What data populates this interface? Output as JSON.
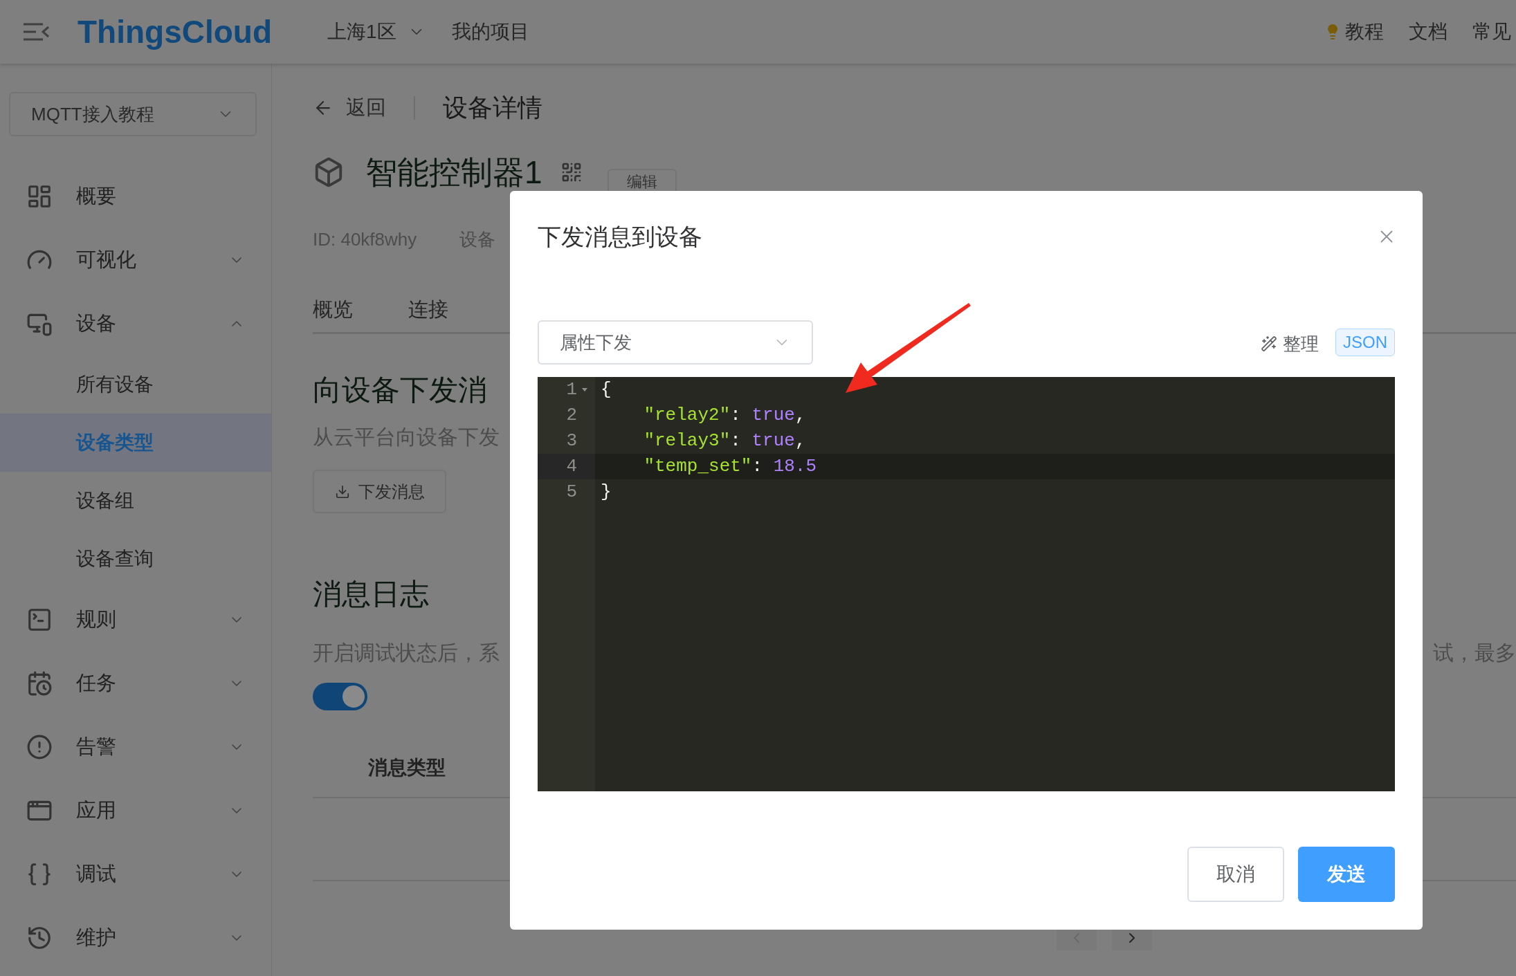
{
  "top_bar": {
    "logo": "ThingsCloud",
    "region": "上海1区",
    "project_link": "我的项目",
    "links": [
      "教程",
      "文档",
      "常见"
    ]
  },
  "sidebar": {
    "project_select": "MQTT接入教程",
    "items": [
      {
        "kind": "link",
        "label": "概要"
      },
      {
        "kind": "group",
        "label": "可视化",
        "expanded": false
      },
      {
        "kind": "group",
        "label": "设备",
        "expanded": true,
        "children": [
          {
            "label": "所有设备",
            "selected": false
          },
          {
            "label": "设备类型",
            "selected": true
          },
          {
            "label": "设备组",
            "selected": false
          },
          {
            "label": "设备查询",
            "selected": false
          }
        ]
      },
      {
        "kind": "group",
        "label": "规则",
        "expanded": false
      },
      {
        "kind": "group",
        "label": "任务",
        "expanded": false
      },
      {
        "kind": "group",
        "label": "告警",
        "expanded": false
      },
      {
        "kind": "group",
        "label": "应用",
        "expanded": false
      },
      {
        "kind": "group",
        "label": "调试",
        "expanded": false
      },
      {
        "kind": "group",
        "label": "维护",
        "expanded": false
      }
    ]
  },
  "detail": {
    "back": "返回",
    "title": "设备详情",
    "device_name": "智能控制器1",
    "edit": "编辑",
    "id": "ID: 40kf8why",
    "meta": "设备",
    "tabs": [
      "概览",
      "连接"
    ]
  },
  "send_section": {
    "heading": "向设备下发消",
    "description": "从云平台向设备下发",
    "button": "下发消息"
  },
  "log_section": {
    "heading": "消息日志",
    "description": "开启调试状态后，系",
    "description_right": "试，最多",
    "debug_on": true,
    "columns": [
      "消息类型"
    ]
  },
  "modal": {
    "title": "下发消息到设备",
    "type_select": "属性下发",
    "format_action": "整理",
    "format_badge": "JSON",
    "editor": {
      "lines": [
        {
          "number": "1",
          "foldable": true,
          "active": false,
          "tokens": [
            {
              "kind": "punct",
              "text": "{"
            }
          ]
        },
        {
          "number": "2",
          "foldable": false,
          "active": false,
          "tokens": [
            {
              "kind": "key",
              "text": "    \"relay2\""
            },
            {
              "kind": "punct",
              "text": ": "
            },
            {
              "kind": "literal",
              "text": "true"
            },
            {
              "kind": "punct",
              "text": ","
            }
          ]
        },
        {
          "number": "3",
          "foldable": false,
          "active": false,
          "tokens": [
            {
              "kind": "key",
              "text": "    \"relay3\""
            },
            {
              "kind": "punct",
              "text": ": "
            },
            {
              "kind": "literal",
              "text": "true"
            },
            {
              "kind": "punct",
              "text": ","
            }
          ]
        },
        {
          "number": "4",
          "foldable": false,
          "active": true,
          "tokens": [
            {
              "kind": "key",
              "text": "    \"temp_set\""
            },
            {
              "kind": "punct",
              "text": ": "
            },
            {
              "kind": "literal",
              "text": "18.5"
            }
          ]
        },
        {
          "number": "5",
          "foldable": false,
          "active": false,
          "tokens": [
            {
              "kind": "punct",
              "text": "}"
            }
          ]
        }
      ]
    },
    "buttons": [
      {
        "label": "取消",
        "kind": "default"
      },
      {
        "label": "发送",
        "kind": "primary"
      }
    ]
  }
}
